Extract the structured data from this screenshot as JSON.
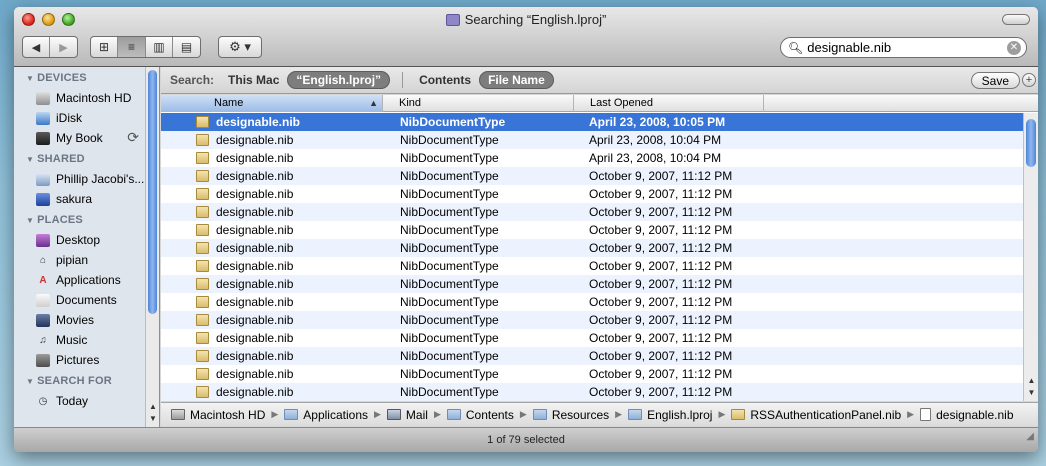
{
  "window": {
    "title": "Searching “English.lproj”"
  },
  "toolbar": {
    "back_label": "◀",
    "forward_label": "▶",
    "view_icon": "⊞",
    "view_list": "≡",
    "view_column": "▥",
    "view_coverflow": "▤",
    "action_label": "⚙ ▾"
  },
  "search": {
    "value": "designable.nib",
    "clear_icon": "✕"
  },
  "sidebar": {
    "sections": [
      {
        "title": "DEVICES",
        "items": [
          "Macintosh HD",
          "iDisk",
          "My Book"
        ]
      },
      {
        "title": "SHARED",
        "items": [
          "Phillip Jacobi's...",
          "sakura"
        ]
      },
      {
        "title": "PLACES",
        "items": [
          "Desktop",
          "pipian",
          "Applications",
          "Documents",
          "Movies",
          "Music",
          "Pictures"
        ]
      },
      {
        "title": "SEARCH FOR",
        "items": [
          "Today"
        ]
      }
    ]
  },
  "searchbar": {
    "label": "Search:",
    "scope_this_mac": "This Mac",
    "scope_folder": "“English.lproj”",
    "criteria_contents": "Contents",
    "criteria_filename": "File Name",
    "save_label": "Save",
    "add_label": "+"
  },
  "columns": {
    "name": "Name",
    "kind": "Kind",
    "last_opened": "Last Opened"
  },
  "rows": [
    {
      "name": "designable.nib",
      "kind": "NibDocumentType",
      "date": "April 23, 2008, 10:05 PM"
    },
    {
      "name": "designable.nib",
      "kind": "NibDocumentType",
      "date": "April 23, 2008, 10:04 PM"
    },
    {
      "name": "designable.nib",
      "kind": "NibDocumentType",
      "date": "April 23, 2008, 10:04 PM"
    },
    {
      "name": "designable.nib",
      "kind": "NibDocumentType",
      "date": "October 9, 2007, 11:12 PM"
    },
    {
      "name": "designable.nib",
      "kind": "NibDocumentType",
      "date": "October 9, 2007, 11:12 PM"
    },
    {
      "name": "designable.nib",
      "kind": "NibDocumentType",
      "date": "October 9, 2007, 11:12 PM"
    },
    {
      "name": "designable.nib",
      "kind": "NibDocumentType",
      "date": "October 9, 2007, 11:12 PM"
    },
    {
      "name": "designable.nib",
      "kind": "NibDocumentType",
      "date": "October 9, 2007, 11:12 PM"
    },
    {
      "name": "designable.nib",
      "kind": "NibDocumentType",
      "date": "October 9, 2007, 11:12 PM"
    },
    {
      "name": "designable.nib",
      "kind": "NibDocumentType",
      "date": "October 9, 2007, 11:12 PM"
    },
    {
      "name": "designable.nib",
      "kind": "NibDocumentType",
      "date": "October 9, 2007, 11:12 PM"
    },
    {
      "name": "designable.nib",
      "kind": "NibDocumentType",
      "date": "October 9, 2007, 11:12 PM"
    },
    {
      "name": "designable.nib",
      "kind": "NibDocumentType",
      "date": "October 9, 2007, 11:12 PM"
    },
    {
      "name": "designable.nib",
      "kind": "NibDocumentType",
      "date": "October 9, 2007, 11:12 PM"
    },
    {
      "name": "designable.nib",
      "kind": "NibDocumentType",
      "date": "October 9, 2007, 11:12 PM"
    },
    {
      "name": "designable.nib",
      "kind": "NibDocumentType",
      "date": "October 9, 2007, 11:12 PM"
    }
  ],
  "selected_row": 0,
  "pathbar": [
    "Macintosh HD",
    "Applications",
    "Mail",
    "Contents",
    "Resources",
    "English.lproj",
    "RSSAuthenticationPanel.nib",
    "designable.nib"
  ],
  "status": "1 of 79 selected",
  "colors": {
    "selection": "#3875d7",
    "alt_row": "#edf3fe",
    "sidebar_bg": "#dfe5ec"
  }
}
